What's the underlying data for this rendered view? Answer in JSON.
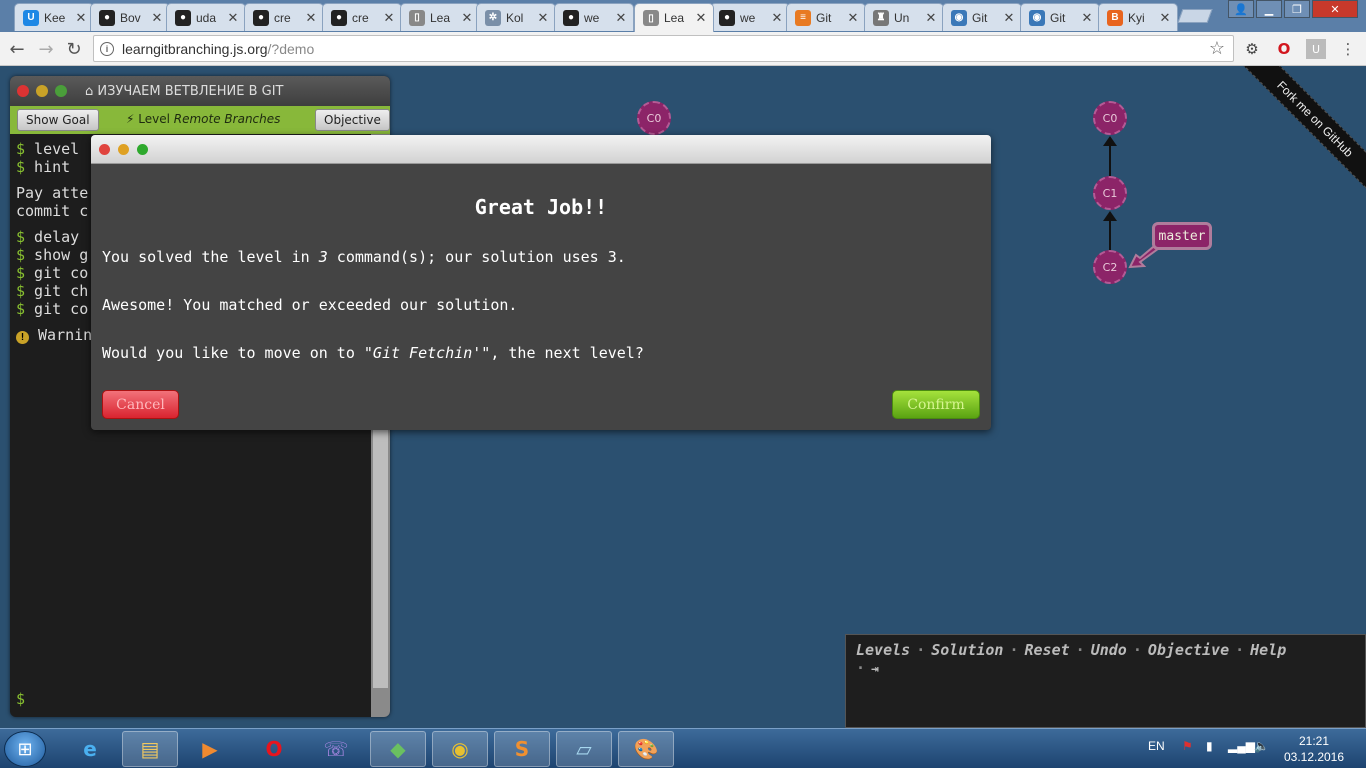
{
  "browser": {
    "tabs": [
      {
        "label": "Kee",
        "color": "#1e88e5",
        "glyph": "U"
      },
      {
        "label": "Bov",
        "color": "#222222",
        "glyph": "●"
      },
      {
        "label": "uda",
        "color": "#222222",
        "glyph": "●"
      },
      {
        "label": "cre",
        "color": "#222222",
        "glyph": "●"
      },
      {
        "label": "cre",
        "color": "#222222",
        "glyph": "●"
      },
      {
        "label": "Lea",
        "color": "#888888",
        "glyph": "▯"
      },
      {
        "label": "Kol",
        "color": "#7a8fa8",
        "glyph": "✲"
      },
      {
        "label": "we",
        "color": "#222222",
        "glyph": "●"
      },
      {
        "label": "Lea",
        "color": "#888888",
        "glyph": "▯"
      },
      {
        "label": "we",
        "color": "#222222",
        "glyph": "●"
      },
      {
        "label": "Git",
        "color": "#e87a22",
        "glyph": "≡"
      },
      {
        "label": "Un",
        "color": "#777777",
        "glyph": "♜"
      },
      {
        "label": "Git",
        "color": "#3a78b8",
        "glyph": "◉"
      },
      {
        "label": "Git",
        "color": "#3a78b8",
        "glyph": "◉"
      },
      {
        "label": "Kyi",
        "color": "#e8641e",
        "glyph": "B"
      }
    ],
    "active_tab_index": 8,
    "url_host": "learngitbranching.js.org",
    "url_path": "/?demo"
  },
  "terminal": {
    "title": "ИЗУЧАЕМ ВЕТВЛЕНИЕ В GIT",
    "show_goal": "Show Goal",
    "level_prefix": "Level",
    "level_name": "Remote Branches",
    "objective": "Objective",
    "lines": [
      {
        "prompt": "$",
        "text": " level"
      },
      {
        "prompt": "$",
        "text": " hint"
      },
      {
        "prompt": "",
        "text": "Pay atte"
      },
      {
        "prompt": "",
        "text": "commit c"
      },
      {
        "prompt": "$",
        "text": " delay"
      },
      {
        "prompt": "$",
        "text": " show g"
      },
      {
        "prompt": "$",
        "text": " git co"
      },
      {
        "prompt": "$",
        "text": " git ch"
      },
      {
        "prompt": "$",
        "text": " git co"
      }
    ],
    "warning": "Warnin",
    "prompt": "$"
  },
  "graph": {
    "nodes": [
      "C0",
      "C0",
      "C1",
      "C2"
    ],
    "branch": "master"
  },
  "ribbon": "Fork me on GitHub",
  "modal": {
    "title": "Great Job!!",
    "solved_prefix": "You solved the level in ",
    "solved_count": "3",
    "solved_suffix": " command(s); our solution uses 3.",
    "awesome": "Awesome! You matched or exceeded our solution.",
    "next_prefix": "Would you like to move on to ",
    "next_level": "\"Git Fetchin'\"",
    "next_suffix": ", the next level?",
    "cancel": "Cancel",
    "confirm": "Confirm"
  },
  "commandbar": {
    "items": [
      "Levels",
      "Solution",
      "Reset",
      "Undo",
      "Objective",
      "Help"
    ]
  },
  "taskbar": {
    "lang": "EN",
    "time": "21:21",
    "date": "03.12.2016"
  }
}
